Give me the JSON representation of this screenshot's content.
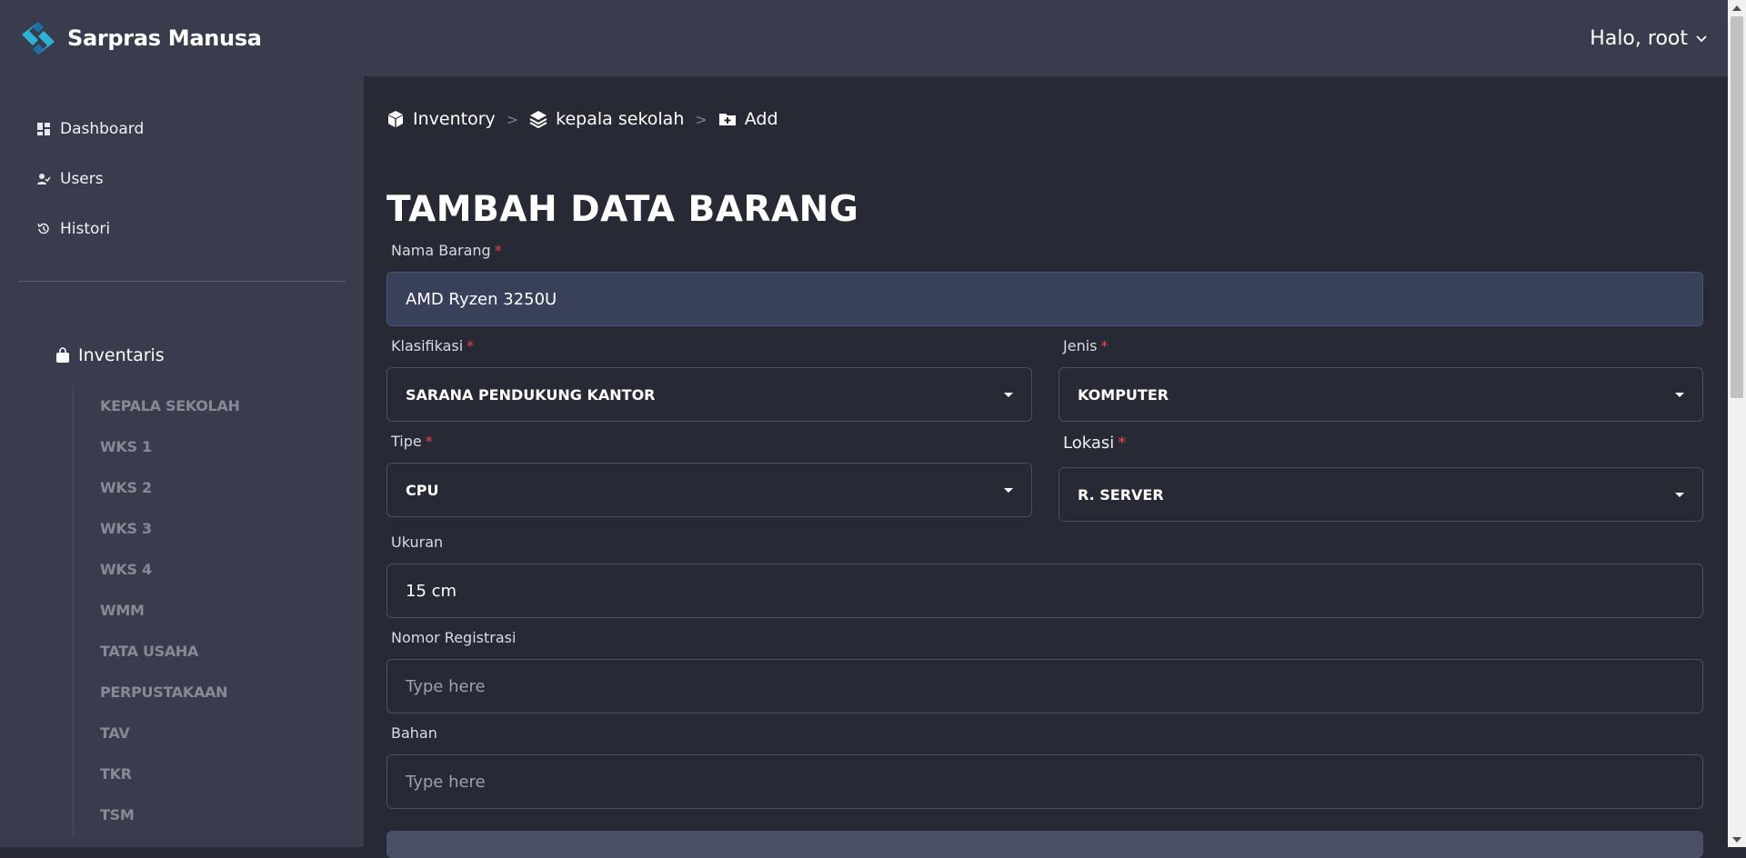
{
  "header": {
    "brand_name": "Sarpras Manusa",
    "user_greeting": "Halo, root",
    "colors": {
      "logo_primary": "#2bb3d6",
      "logo_secondary": "#1e6fa8",
      "bar": "#383c4d"
    }
  },
  "sidebar": {
    "nav": [
      {
        "label": "Dashboard",
        "icon": "dashboard-icon"
      },
      {
        "label": "Users",
        "icon": "user-check-icon"
      },
      {
        "label": "Histori",
        "icon": "history-icon"
      }
    ],
    "section": {
      "label": "Inventaris",
      "icon": "shopping-bag-icon"
    },
    "sub_items": [
      "KEPALA SEKOLAH",
      "WKS 1",
      "WKS 2",
      "WKS 3",
      "WKS 4",
      "WMM",
      "TATA USAHA",
      "PERPUSTAKAAN",
      "TAV",
      "TKR",
      "TSM"
    ]
  },
  "breadcrumb": {
    "items": [
      {
        "label": "Inventory",
        "icon": "box-icon"
      },
      {
        "label": "kepala sekolah",
        "icon": "layers-icon"
      },
      {
        "label": "Add",
        "icon": "folder-plus-icon"
      }
    ],
    "separator": ">"
  },
  "form": {
    "title": "TAMBAH DATA BARANG",
    "required_mark": "*",
    "nama_barang": {
      "label": "Nama Barang",
      "value": "AMD Ryzen 3250U"
    },
    "klasifikasi": {
      "label": "Klasifikasi",
      "value": "SARANA PENDUKUNG KANTOR"
    },
    "jenis": {
      "label": "Jenis",
      "value": "KOMPUTER"
    },
    "tipe": {
      "label": "Tipe",
      "value": "CPU"
    },
    "lokasi": {
      "label": "Lokasi",
      "value": "R. SERVER"
    },
    "ukuran": {
      "label": "Ukuran",
      "value": "15 cm"
    },
    "nomor_registrasi": {
      "label": "Nomor Registrasi",
      "placeholder": "Type here"
    },
    "bahan": {
      "label": "Bahan",
      "placeholder": "Type here"
    }
  }
}
